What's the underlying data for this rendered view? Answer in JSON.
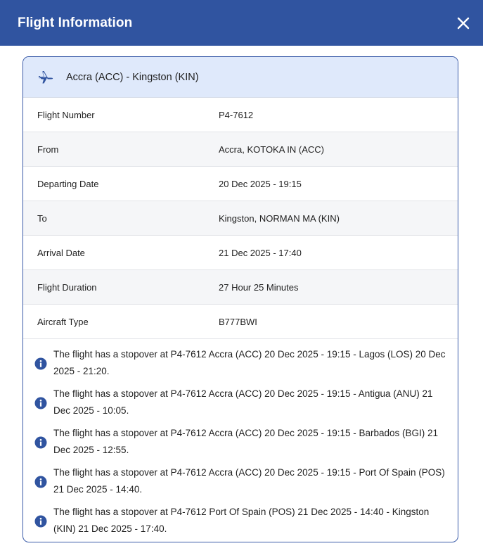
{
  "header": {
    "title": "Flight Information"
  },
  "icons": {
    "close": "close-icon",
    "plane": "airplane-icon",
    "info": "info-icon"
  },
  "colors": {
    "header_bg": "#3054a0",
    "card_border": "#3a5ba8",
    "card_head_bg": "#dfe9fb",
    "info_icon": "#3054a0"
  },
  "card": {
    "route": "Accra (ACC) - Kingston (KIN)",
    "rows": [
      {
        "label": "Flight Number",
        "value": "P4-7612"
      },
      {
        "label": "From",
        "value": "Accra, KOTOKA IN (ACC)"
      },
      {
        "label": "Departing Date",
        "value": "20 Dec 2025 - 19:15"
      },
      {
        "label": "To",
        "value": "Kingston, NORMAN MA (KIN)"
      },
      {
        "label": "Arrival Date",
        "value": "21 Dec 2025 - 17:40"
      },
      {
        "label": "Flight Duration",
        "value": "27 Hour 25 Minutes"
      },
      {
        "label": "Aircraft Type",
        "value": "B777BWI"
      }
    ],
    "stopovers": [
      "The flight has a stopover at P4-7612 Accra (ACC) 20 Dec 2025 - 19:15 - Lagos (LOS) 20 Dec 2025 - 21:20.",
      "The flight has a stopover at P4-7612 Accra (ACC) 20 Dec 2025 - 19:15 - Antigua (ANU) 21 Dec 2025 - 10:05.",
      "The flight has a stopover at P4-7612 Accra (ACC) 20 Dec 2025 - 19:15 - Barbados (BGI) 21 Dec 2025 - 12:55.",
      "The flight has a stopover at P4-7612 Accra (ACC) 20 Dec 2025 - 19:15 - Port Of Spain (POS) 21 Dec 2025 - 14:40.",
      "The flight has a stopover at P4-7612 Port Of Spain (POS) 21 Dec 2025 - 14:40 - Kingston (KIN) 21 Dec 2025 - 17:40."
    ]
  }
}
